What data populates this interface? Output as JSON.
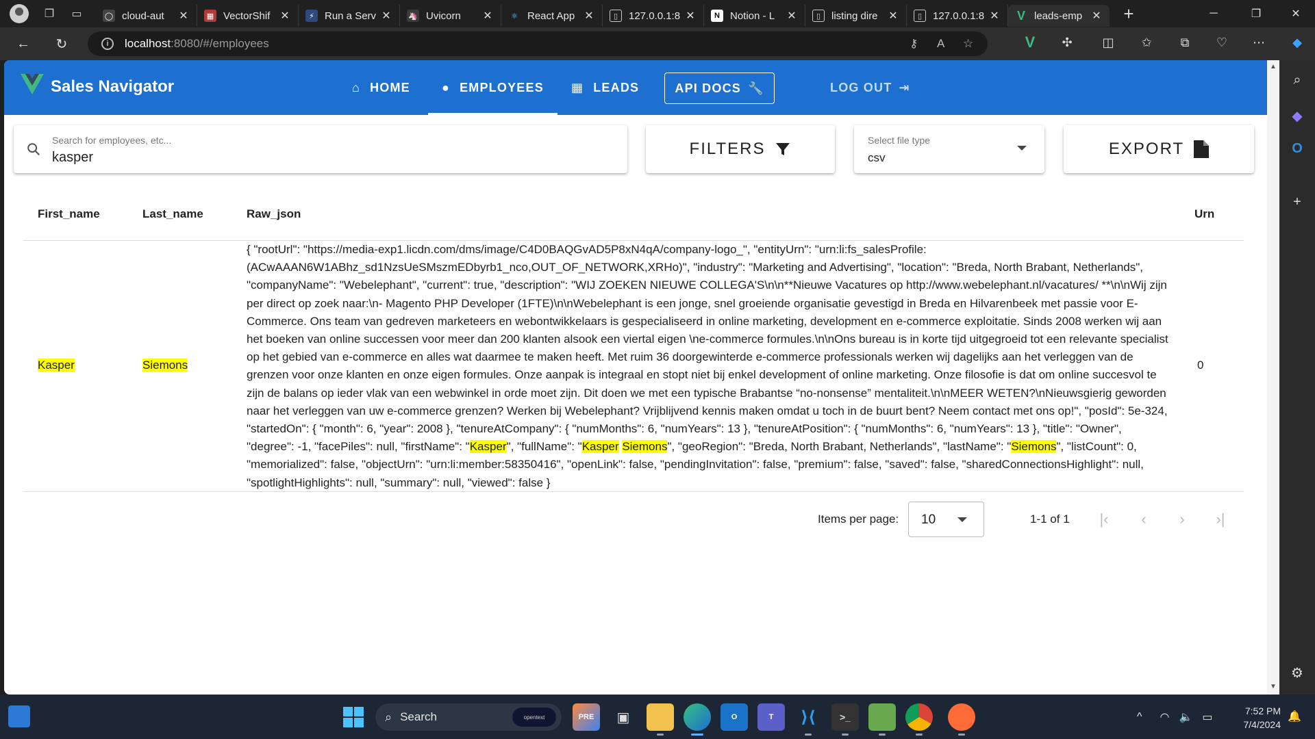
{
  "browser": {
    "tabs": [
      {
        "title": "cloud-aut",
        "favicon": "github",
        "color": "#444444"
      },
      {
        "title": "VectorShif",
        "favicon": "vs",
        "color": "#b33a3a"
      },
      {
        "title": "Run a Serv",
        "favicon": "run",
        "color": "#2c4a7d"
      },
      {
        "title": "Uvicorn",
        "favicon": "uv",
        "color": "#3a3a3a"
      },
      {
        "title": "React App",
        "favicon": "react",
        "color": "#20232a"
      },
      {
        "title": "127.0.0.1:8",
        "favicon": "doc",
        "color": "#3a3a3a"
      },
      {
        "title": "Notion - L",
        "favicon": "N",
        "color": "#ffffff"
      },
      {
        "title": "listing dire",
        "favicon": "doc",
        "color": "#3a3a3a"
      },
      {
        "title": "127.0.0.1:8",
        "favicon": "doc",
        "color": "#3a3a3a"
      },
      {
        "title": "leads-emp",
        "favicon": "vue",
        "color": "#41b883"
      }
    ],
    "url_host": "localhost",
    "url_path": ":8080/#/employees"
  },
  "app": {
    "brand": "Sales Navigator",
    "brand_color": "#1d6fd0",
    "nav": {
      "home": "HOME",
      "employees": "EMPLOYEES",
      "leads": "LEADS",
      "api_docs": "API DOCS",
      "logout": "LOG OUT"
    }
  },
  "controls": {
    "search": {
      "label": "Search for employees, etc...",
      "value": "kasper"
    },
    "filters_label": "FILTERS",
    "file_type": {
      "label": "Select file type",
      "value": "csv"
    },
    "export_label": "EXPORT"
  },
  "table": {
    "headers": [
      "First_name",
      "Last_name",
      "Raw_json",
      "Urn"
    ],
    "rows": [
      {
        "first_name": "Kasper",
        "last_name": "Siemons",
        "raw_json_parts": [
          "{ \"rootUrl\": \"https://media-exp1.licdn.com/dms/image/C4D0BAQGvAD5P8xN4qA/company-logo_\", \"entityUrn\": \"urn:li:fs_salesProfile:(ACwAAAN6W1ABhz_sd1NzsUeSMszmEDbyrb1_nco,OUT_OF_NETWORK,XRHo)\", \"industry\": \"Marketing and Advertising\", \"location\": \"Breda, North Brabant, Netherlands\", \"companyName\": \"Webelephant\", \"current\": true, \"description\": \"WIJ ZOEKEN NIEUWE COLLEGA'S\\n\\n**Nieuwe Vacatures op http://www.webelephant.nl/vacatures/ **\\n\\nWij zijn per direct op zoek naar:\\n- Magento PHP Developer (1FTE)\\n\\nWebelephant is een jonge, snel groeiende organisatie gevestigd in Breda en Hilvarenbeek met passie voor E-Commerce. Ons team van gedreven marketeers en webontwikkelaars is gespecialiseerd in online marketing, development en e-commerce exploitatie. Sinds 2008 werken wij aan het boeken van online successen voor meer dan 200 klanten alsook een viertal eigen \\ne-commerce formules.\\n\\nOns bureau is in korte tijd uitgegroeid tot een relevante specialist op het gebied van e-commerce en alles wat daarmee te maken heeft. Met ruim 36 doorgewinterde e-commerce professionals werken wij dagelijks aan het verleggen van de grenzen voor onze klanten en onze eigen formules. Onze aanpak is integraal en stopt niet bij enkel development of online marketing. Onze filosofie is dat om online succesvol te zijn de balans op ieder vlak van een webwinkel in orde moet zijn. Dit doen we met een typische Brabantse “no-nonsense” mentaliteit.\\n\\nMEER WETEN?\\nNieuwsgierig geworden naar het verleggen van uw e-commerce grenzen? Werken bij Webelephant? Vrijblijvend kennis maken omdat u toch in de buurt bent? Neem contact met ons op!\", \"posId\": 5e-324, \"startedOn\": { \"month\": 6, \"year\": 2008 }, \"tenureAtCompany\": { \"numMonths\": 6, \"numYears\": 13 }, \"tenureAtPosition\": { \"numMonths\": 6, \"numYears\": 13 }, \"title\": \"Owner\", \"degree\": -1, \"facePiles\": null, \"firstName\": \"",
          "Kasper",
          "\", \"fullName\": \"",
          "Kasper",
          " ",
          "Siemons",
          "\", \"geoRegion\": \"Breda, North Brabant, Netherlands\", \"lastName\": \"",
          "Siemons",
          "\", \"listCount\": 0, \"memorialized\": false, \"objectUrn\": \"urn:li:member:58350416\", \"openLink\": false, \"pendingInvitation\": false, \"premium\": false, \"saved\": false, \"sharedConnectionsHighlight\": null, \"spotlightHighlights\": null, \"summary\": null, \"viewed\": false }"
        ],
        "urn": "0"
      }
    ],
    "highlight_color": "#ffff00"
  },
  "pagination": {
    "items_per_page_label": "Items per page:",
    "items_per_page": "10",
    "range": "1-1 of 1"
  },
  "taskbar": {
    "search_label": "Search",
    "search_badge": "opentext",
    "time": "7:52 PM",
    "date": "7/4/2024"
  }
}
